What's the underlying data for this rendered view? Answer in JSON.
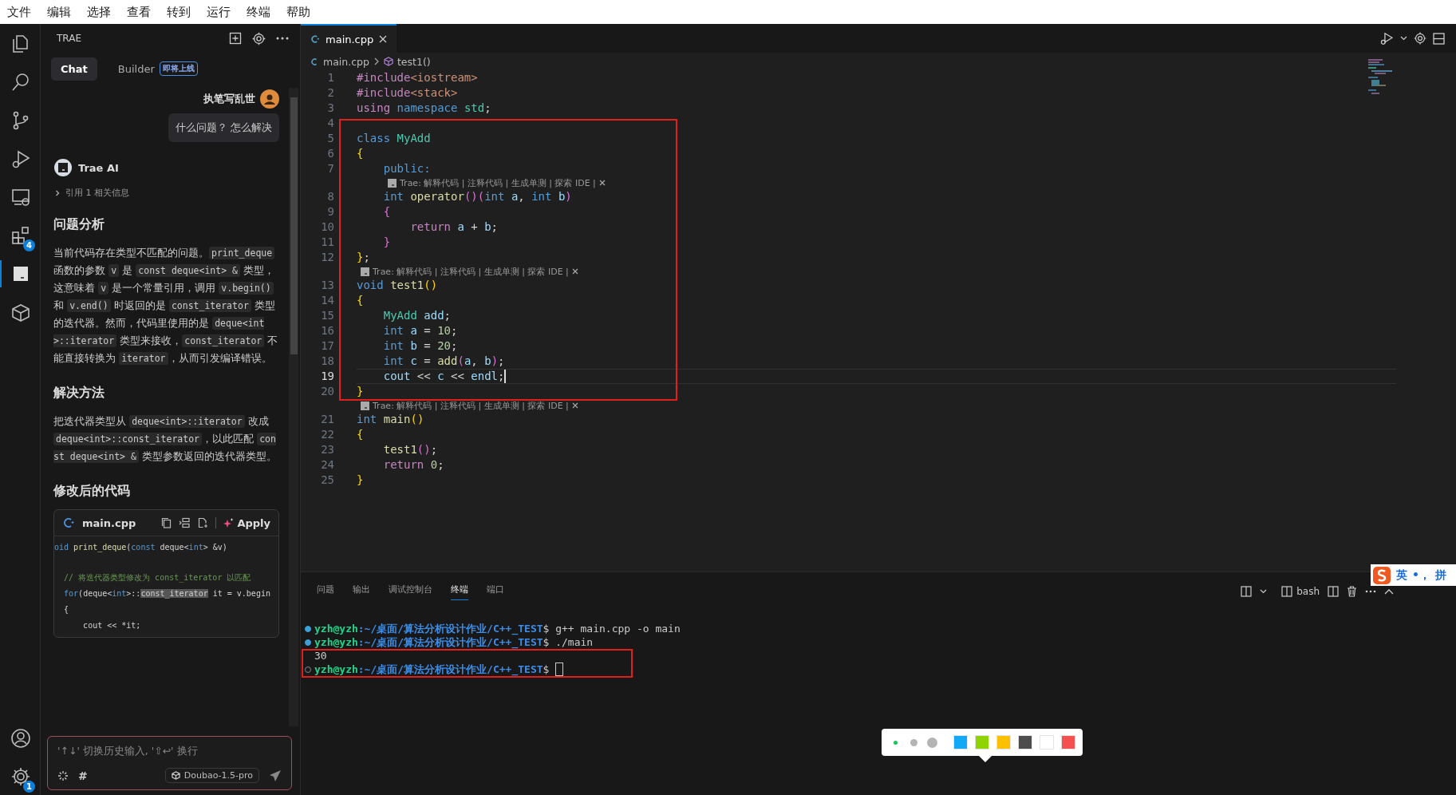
{
  "menu": [
    "文件",
    "编辑",
    "选择",
    "查看",
    "转到",
    "运行",
    "终端",
    "帮助"
  ],
  "activity_bar": {
    "top": [
      {
        "selected": false
      },
      {
        "selected": false
      },
      {
        "selected": false
      },
      {
        "selected": false
      },
      {
        "selected": false
      },
      {
        "selected": false,
        "badge": "4"
      },
      {
        "selected": true
      },
      {
        "selected": false
      }
    ],
    "bottom": [
      {
        "selected": false
      },
      {
        "selected": false,
        "badge": "1"
      }
    ]
  },
  "chat": {
    "title": "TRAE",
    "tabs": [
      {
        "label": "Chat",
        "selected": true
      },
      {
        "label": "Builder",
        "selected": false,
        "badge": "即将上线"
      }
    ],
    "user": {
      "name": "执笔写乱世",
      "message": "什么问题？ 怎么解决"
    },
    "assistant": {
      "name": "Trae AI",
      "reference": "引用 1 相关信息"
    },
    "sections": [
      {
        "heading": "问题分析",
        "paragraph": [
          {
            "kind": "text",
            "text": "当前代码存在类型不匹配的问题。"
          },
          {
            "kind": "code",
            "text": "print_deque"
          },
          {
            "kind": "text",
            "text": " 函数的参数 "
          },
          {
            "kind": "code",
            "text": "v"
          },
          {
            "kind": "text",
            "text": " 是 "
          },
          {
            "kind": "code",
            "text": "const deque<int> &"
          },
          {
            "kind": "text",
            "text": " 类型，这意味着 "
          },
          {
            "kind": "code",
            "text": "v"
          },
          {
            "kind": "text",
            "text": " 是一个常量引用，调用 "
          },
          {
            "kind": "code",
            "text": "v.begin()"
          },
          {
            "kind": "text",
            "text": " 和 "
          },
          {
            "kind": "code",
            "text": "v.end()"
          },
          {
            "kind": "text",
            "text": " 时返回的是 "
          },
          {
            "kind": "code",
            "text": "const_iterator"
          },
          {
            "kind": "text",
            "text": " 类型的迭代器。然而，代码里使用的是 "
          },
          {
            "kind": "code",
            "text": "deque<int>::iterator"
          },
          {
            "kind": "text",
            "text": " 类型来接收，"
          },
          {
            "kind": "code",
            "text": "const_iterator"
          },
          {
            "kind": "text",
            "text": " 不能直接转换为 "
          },
          {
            "kind": "code",
            "text": "iterator"
          },
          {
            "kind": "text",
            "text": "，从而引发编译错误。"
          }
        ]
      },
      {
        "heading": "解决方法",
        "paragraph": [
          {
            "kind": "text",
            "text": "把迭代器类型从 "
          },
          {
            "kind": "code",
            "text": "deque<int>::iterator"
          },
          {
            "kind": "text",
            "text": " 改成 "
          },
          {
            "kind": "code",
            "text": "deque<int>::const_iterator"
          },
          {
            "kind": "text",
            "text": "，以此匹配 "
          },
          {
            "kind": "code",
            "text": "const deque<int> &"
          },
          {
            "kind": "text",
            "text": " 类型参数返回的迭代器类型。"
          }
        ]
      },
      {
        "heading": "修改后的代码"
      }
    ],
    "code_block": {
      "filename": "main.cpp",
      "apply": "Apply",
      "lines": [
        {
          "tokens": [
            {
              "kind": "st",
              "text": "oid"
            },
            {
              "kind": "fn",
              "text": " print_deque"
            },
            {
              "kind": "p",
              "text": "("
            },
            {
              "kind": "st",
              "text": "const"
            },
            {
              "kind": "p",
              "text": " deque<"
            },
            {
              "kind": "st",
              "text": "int"
            },
            {
              "kind": "p",
              "text": "> &v)"
            }
          ]
        },
        {
          "tokens": [
            {
              "kind": "com",
              "text": "  // 将迭代器类型修改为 const_iterator 以匹配"
            }
          ]
        },
        {
          "tokens": [
            {
              "kind": "st",
              "text": "  for"
            },
            {
              "kind": "p",
              "text": "(deque<"
            },
            {
              "kind": "st",
              "text": "int"
            },
            {
              "kind": "p",
              "text": ">::"
            },
            {
              "kind": "hl",
              "text": "const_iterator"
            },
            {
              "kind": "p",
              "text": " it = v.begin"
            }
          ]
        },
        {
          "tokens": [
            {
              "kind": "p",
              "text": "  {"
            }
          ]
        },
        {
          "tokens": [
            {
              "kind": "p",
              "text": "      cout << *it;"
            }
          ]
        }
      ]
    },
    "input": {
      "placeholder": "'↑↓' 切换历史输入, '⇧↩' 换行",
      "hash": "#",
      "model": "Doubao-1.5-pro"
    }
  },
  "editor": {
    "tab": {
      "filename": "main.cpp"
    },
    "breadcrumb": [
      "main.cpp",
      "test1()"
    ],
    "rows": [
      {
        "kind": "code",
        "num": "1",
        "current": false,
        "tokens": [
          {
            "kind": "kw",
            "text": "#include"
          },
          {
            "kind": "inc",
            "text": "<iostream>"
          }
        ]
      },
      {
        "kind": "code",
        "num": "2",
        "current": false,
        "tokens": [
          {
            "kind": "kw",
            "text": "#include"
          },
          {
            "kind": "inc",
            "text": "<stack>"
          }
        ]
      },
      {
        "kind": "code",
        "num": "3",
        "current": false,
        "tokens": [
          {
            "kind": "kw",
            "text": "using"
          },
          {
            "kind": "st",
            "text": " namespace"
          },
          {
            "kind": "ty",
            "text": " std"
          },
          {
            "kind": "p",
            "text": ";"
          }
        ]
      },
      {
        "kind": "code",
        "num": "4",
        "current": false,
        "tokens": []
      },
      {
        "kind": "code",
        "num": "5",
        "current": false,
        "tokens": [
          {
            "kind": "st",
            "text": "class"
          },
          {
            "kind": "ty",
            "text": " MyAdd"
          }
        ]
      },
      {
        "kind": "code",
        "num": "6",
        "current": false,
        "tokens": [
          {
            "kind": "b1",
            "text": "{"
          }
        ]
      },
      {
        "kind": "code",
        "num": "7",
        "current": false,
        "tokens": [
          {
            "kind": "st",
            "text": "    public:"
          }
        ]
      },
      {
        "kind": "lens",
        "indented": true,
        "text": "Trae: 解释代码 | 注释代码 | 生成单测 | 探索 IDE |"
      },
      {
        "kind": "code",
        "num": "8",
        "current": false,
        "tokens": [
          {
            "kind": "st",
            "text": "    int"
          },
          {
            "kind": "fn",
            "text": " operator"
          },
          {
            "kind": "b2",
            "text": "()("
          },
          {
            "kind": "st",
            "text": "int"
          },
          {
            "kind": "var",
            "text": " a"
          },
          {
            "kind": "p",
            "text": ", "
          },
          {
            "kind": "st",
            "text": "int"
          },
          {
            "kind": "var",
            "text": " b"
          },
          {
            "kind": "b2",
            "text": ")"
          }
        ]
      },
      {
        "kind": "code",
        "num": "9",
        "current": false,
        "tokens": [
          {
            "kind": "b2",
            "text": "    {"
          }
        ]
      },
      {
        "kind": "code",
        "num": "10",
        "current": false,
        "tokens": [
          {
            "kind": "kw",
            "text": "        return"
          },
          {
            "kind": "var",
            "text": " a"
          },
          {
            "kind": "p",
            "text": " + "
          },
          {
            "kind": "var",
            "text": "b"
          },
          {
            "kind": "p",
            "text": ";"
          }
        ]
      },
      {
        "kind": "code",
        "num": "11",
        "current": false,
        "tokens": [
          {
            "kind": "b2",
            "text": "    }"
          }
        ]
      },
      {
        "kind": "code",
        "num": "12",
        "current": false,
        "tokens": [
          {
            "kind": "b1",
            "text": "}"
          },
          {
            "kind": "p",
            "text": ";"
          }
        ]
      },
      {
        "kind": "lens",
        "indented": false,
        "text": "Trae: 解释代码 | 注释代码 | 生成单测 | 探索 IDE |"
      },
      {
        "kind": "code",
        "num": "13",
        "current": false,
        "tokens": [
          {
            "kind": "st",
            "text": "void"
          },
          {
            "kind": "fn",
            "text": " test1"
          },
          {
            "kind": "b1",
            "text": "()"
          }
        ]
      },
      {
        "kind": "code",
        "num": "14",
        "current": false,
        "tokens": [
          {
            "kind": "b1",
            "text": "{"
          }
        ]
      },
      {
        "kind": "code",
        "num": "15",
        "current": false,
        "tokens": [
          {
            "kind": "ty",
            "text": "    MyAdd"
          },
          {
            "kind": "var",
            "text": " add"
          },
          {
            "kind": "p",
            "text": ";"
          }
        ]
      },
      {
        "kind": "code",
        "num": "16",
        "current": false,
        "tokens": [
          {
            "kind": "st",
            "text": "    int"
          },
          {
            "kind": "var",
            "text": " a"
          },
          {
            "kind": "p",
            "text": " = "
          },
          {
            "kind": "num",
            "text": "10"
          },
          {
            "kind": "p",
            "text": ";"
          }
        ]
      },
      {
        "kind": "code",
        "num": "17",
        "current": false,
        "tokens": [
          {
            "kind": "st",
            "text": "    int"
          },
          {
            "kind": "var",
            "text": " b"
          },
          {
            "kind": "p",
            "text": " = "
          },
          {
            "kind": "num",
            "text": "20"
          },
          {
            "kind": "p",
            "text": ";"
          }
        ]
      },
      {
        "kind": "code",
        "num": "18",
        "current": false,
        "tokens": [
          {
            "kind": "st",
            "text": "    int"
          },
          {
            "kind": "var",
            "text": " c"
          },
          {
            "kind": "p",
            "text": " = "
          },
          {
            "kind": "fn",
            "text": "add"
          },
          {
            "kind": "b2",
            "text": "("
          },
          {
            "kind": "var",
            "text": "a"
          },
          {
            "kind": "p",
            "text": ", "
          },
          {
            "kind": "var",
            "text": "b"
          },
          {
            "kind": "b2",
            "text": ")"
          },
          {
            "kind": "p",
            "text": ";"
          }
        ]
      },
      {
        "kind": "code",
        "num": "19",
        "current": true,
        "tokens": [
          {
            "kind": "var",
            "text": "    cout"
          },
          {
            "kind": "p",
            "text": " << "
          },
          {
            "kind": "var",
            "text": "c"
          },
          {
            "kind": "p",
            "text": " << "
          },
          {
            "kind": "var",
            "text": "endl"
          },
          {
            "kind": "p",
            "text": ";"
          }
        ]
      },
      {
        "kind": "code",
        "num": "20",
        "current": false,
        "tokens": [
          {
            "kind": "b1",
            "text": "}"
          }
        ]
      },
      {
        "kind": "lens",
        "indented": false,
        "text": "Trae: 解释代码 | 注释代码 | 生成单测 | 探索 IDE |"
      },
      {
        "kind": "code",
        "num": "21",
        "current": false,
        "tokens": [
          {
            "kind": "st",
            "text": "int"
          },
          {
            "kind": "fn",
            "text": " main"
          },
          {
            "kind": "b1",
            "text": "()"
          }
        ]
      },
      {
        "kind": "code",
        "num": "22",
        "current": false,
        "tokens": [
          {
            "kind": "b1",
            "text": "{"
          }
        ]
      },
      {
        "kind": "code",
        "num": "23",
        "current": false,
        "tokens": [
          {
            "kind": "fn",
            "text": "    test1"
          },
          {
            "kind": "b2",
            "text": "()"
          },
          {
            "kind": "p",
            "text": ";"
          }
        ]
      },
      {
        "kind": "code",
        "num": "24",
        "current": false,
        "tokens": [
          {
            "kind": "kw",
            "text": "    return"
          },
          {
            "kind": "num",
            "text": " 0"
          },
          {
            "kind": "p",
            "text": ";"
          }
        ]
      },
      {
        "kind": "code",
        "num": "25",
        "current": false,
        "tokens": [
          {
            "kind": "b1",
            "text": "}"
          }
        ]
      }
    ]
  },
  "panel": {
    "tabs": [
      {
        "label": "问题",
        "selected": false
      },
      {
        "label": "输出",
        "selected": false
      },
      {
        "label": "调试控制台",
        "selected": false
      },
      {
        "label": "终端",
        "selected": true
      },
      {
        "label": "端口",
        "selected": false
      }
    ],
    "shell": "bash",
    "lines": [
      {
        "kind": "prompt",
        "finished": true,
        "cursor": false,
        "user": "yzh@yzh",
        "path": ":~/桌面/算法分析设计作业/C++_TEST",
        "sign": "$",
        "command": "g++ main.cpp -o main"
      },
      {
        "kind": "prompt",
        "finished": true,
        "cursor": false,
        "user": "yzh@yzh",
        "path": ":~/桌面/算法分析设计作业/C++_TEST",
        "sign": "$",
        "command": "./main"
      },
      {
        "kind": "output",
        "text": "30"
      },
      {
        "kind": "prompt",
        "finished": false,
        "cursor": true,
        "user": "yzh@yzh",
        "path": ":~/桌面/算法分析设计作业/C++_TEST",
        "sign": "$"
      }
    ]
  },
  "palette": {
    "sizes": [
      {
        "selected": true
      },
      {
        "selected": false
      },
      {
        "selected": false
      }
    ],
    "colors": [
      {
        "color": "#12a8f5"
      },
      {
        "color": "#8fd400"
      },
      {
        "color": "#fcc000"
      },
      {
        "color": "#4d4d4d"
      },
      {
        "color": "#ffffff"
      },
      {
        "color": "#f55050"
      }
    ]
  },
  "ime": {
    "mode": "英",
    "punctuation": "•，",
    "layout": "拼"
  }
}
